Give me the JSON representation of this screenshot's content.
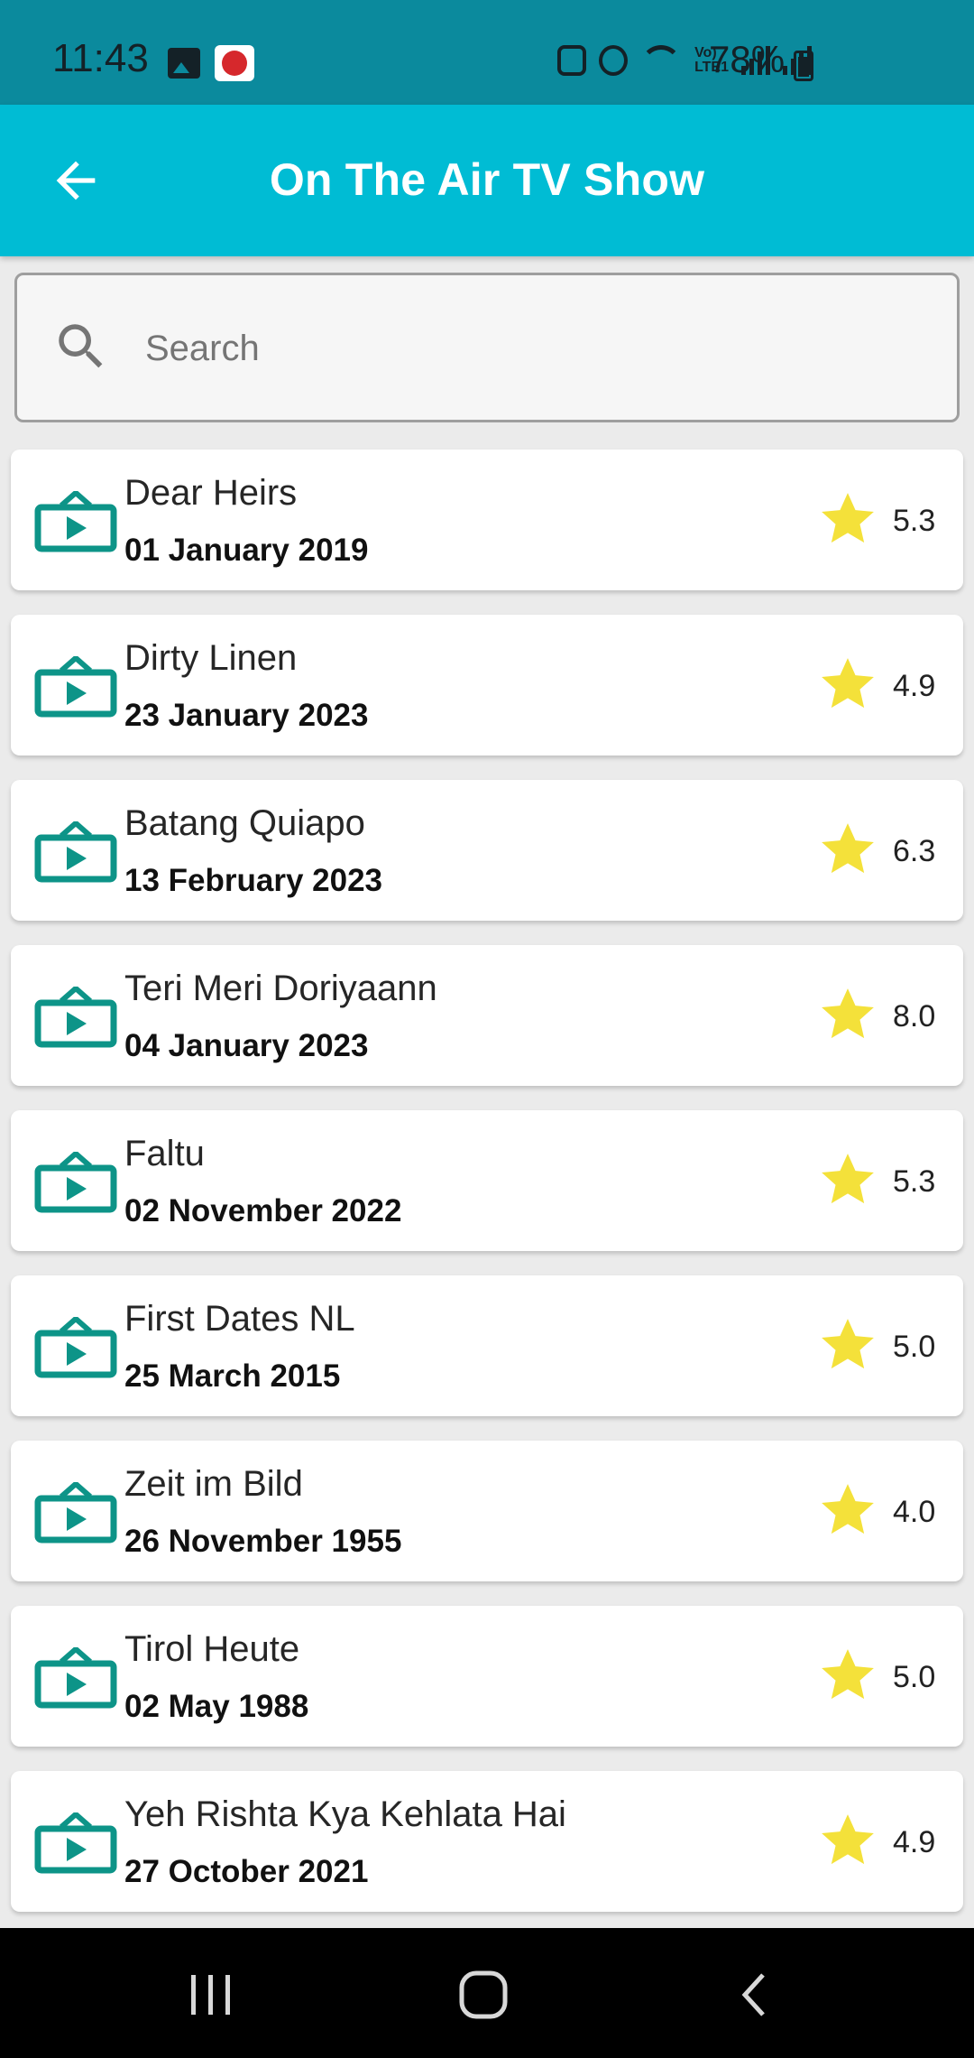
{
  "status_bar": {
    "time": "11:43",
    "battery": "78%",
    "icons": [
      "image-icon",
      "pizza-app-icon",
      "battery-saver-icon",
      "alarm-icon",
      "wifi-icon",
      "volte-icon",
      "signal-icon",
      "signal-icon",
      "battery-charging-icon"
    ]
  },
  "app_bar": {
    "title": "On The Air TV Show",
    "back_icon": "arrow-back-icon",
    "color": "#00bcd4"
  },
  "search": {
    "placeholder": "Search",
    "value": "",
    "icon": "search-icon"
  },
  "shows": [
    {
      "name": "Dear Heirs",
      "date": "01 January 2019",
      "rating": "5.3"
    },
    {
      "name": "Dirty Linen",
      "date": "23 January 2023",
      "rating": "4.9"
    },
    {
      "name": "Batang Quiapo",
      "date": "13 February 2023",
      "rating": "6.3"
    },
    {
      "name": "Teri Meri Doriyaann",
      "date": "04 January 2023",
      "rating": "8.0"
    },
    {
      "name": "Faltu",
      "date": "02 November 2022",
      "rating": "5.3"
    },
    {
      "name": "First Dates NL",
      "date": "25 March 2015",
      "rating": "5.0"
    },
    {
      "name": "Zeit im Bild",
      "date": "26 November 1955",
      "rating": "4.0"
    },
    {
      "name": "Tirol Heute",
      "date": "02 May 1988",
      "rating": "5.0"
    },
    {
      "name": "Yeh Rishta Kya Kehlata Hai",
      "date": "27 October 2021",
      "rating": "4.9"
    }
  ],
  "colors": {
    "tv_icon": "#0d9488",
    "star": "#f4e13a"
  },
  "nav_bar": {
    "recents_icon": "recents-icon",
    "home_icon": "home-icon",
    "back_icon": "back-chevron-icon"
  }
}
